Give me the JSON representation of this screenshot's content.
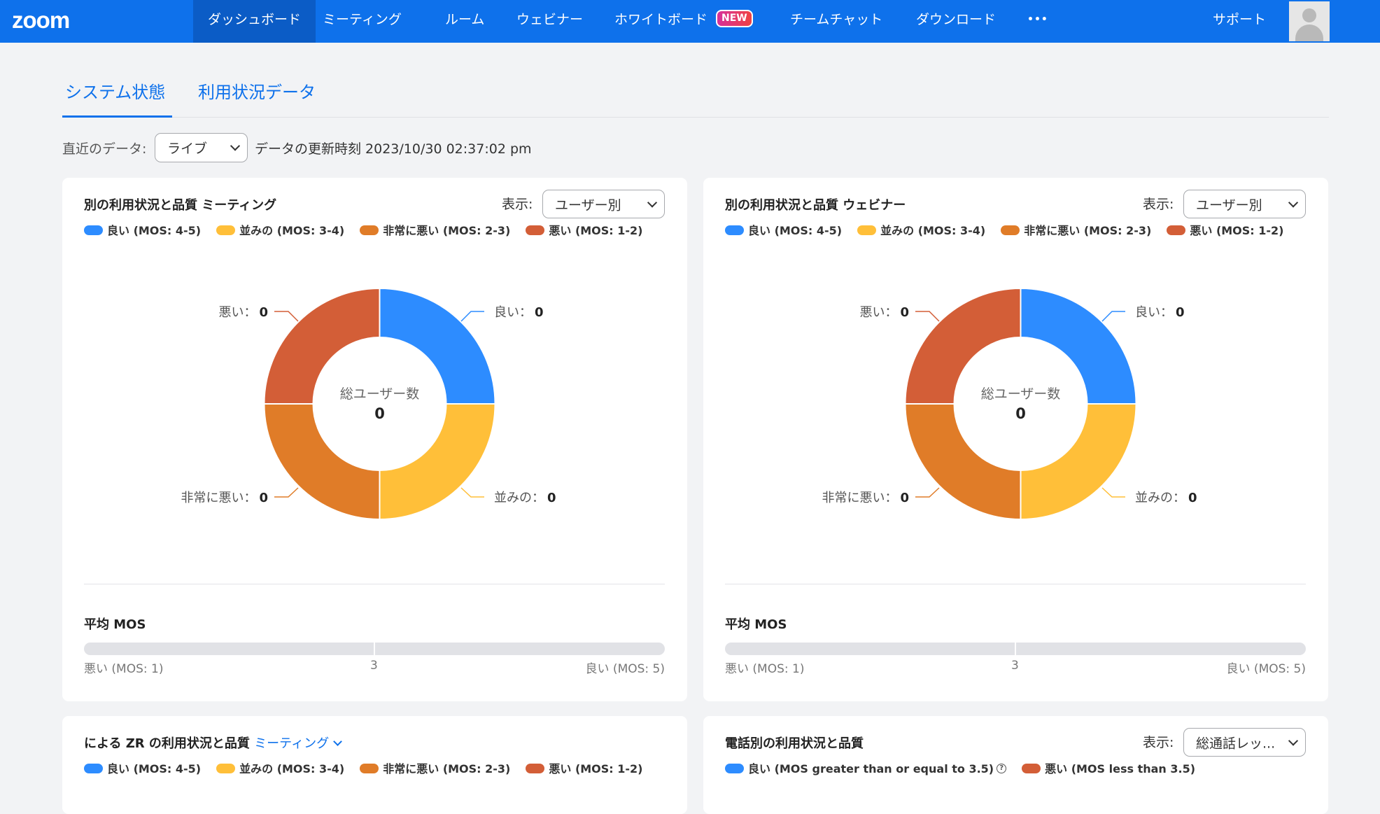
{
  "nav": {
    "logo": "zoom",
    "items": [
      {
        "label": "ダッシュボード",
        "active": true
      },
      {
        "label": "ミーティング"
      },
      {
        "label": "ルーム"
      },
      {
        "label": "ウェビナー"
      },
      {
        "label": "ホワイトボード",
        "badge": "NEW"
      },
      {
        "label": "チームチャット"
      },
      {
        "label": "ダウンロード"
      },
      {
        "label": "•••"
      }
    ],
    "support": "サポート"
  },
  "tabs": [
    {
      "label": "システム状態",
      "active": true
    },
    {
      "label": "利用状況データ"
    }
  ],
  "filter": {
    "label": "直近のデータ:",
    "value": "ライブ",
    "updated": "データの更新時刻 2023/10/30 02:37:02 pm"
  },
  "colors": {
    "good": "#2d8cff",
    "fair": "#ffbf39",
    "poor": "#e07c28",
    "bad": "#d35e37"
  },
  "cards": [
    {
      "title": "別の利用状況と品質 ミーティング",
      "display_label": "表示:",
      "display_value": "ユーザー別",
      "legend": [
        "良い (MOS: 4-5)",
        "並みの (MOS: 3-4)",
        "非常に悪い (MOS: 2-3)",
        "悪い (MOS: 1-2)"
      ],
      "center_label": "総ユーザー数",
      "center_value": "0",
      "segments": [
        {
          "label": "良い：",
          "value": "0"
        },
        {
          "label": "並みの：",
          "value": "0"
        },
        {
          "label": "非常に悪い：",
          "value": "0"
        },
        {
          "label": "悪い：",
          "value": "0"
        }
      ],
      "mos_title": "平均 MOS",
      "mos_left": "悪い (MOS: 1)",
      "mos_mid": "3",
      "mos_right": "良い (MOS: 5)"
    },
    {
      "title": "別の利用状況と品質 ウェビナー",
      "display_label": "表示:",
      "display_value": "ユーザー別",
      "legend": [
        "良い (MOS: 4-5)",
        "並みの (MOS: 3-4)",
        "非常に悪い (MOS: 2-3)",
        "悪い (MOS: 1-2)"
      ],
      "center_label": "総ユーザー数",
      "center_value": "0",
      "segments": [
        {
          "label": "良い：",
          "value": "0"
        },
        {
          "label": "並みの：",
          "value": "0"
        },
        {
          "label": "非常に悪い：",
          "value": "0"
        },
        {
          "label": "悪い：",
          "value": "0"
        }
      ],
      "mos_title": "平均 MOS",
      "mos_left": "悪い (MOS: 1)",
      "mos_mid": "3",
      "mos_right": "良い (MOS: 5)"
    },
    {
      "title_prefix": "による ZR の利用状況と品質",
      "title_link": "ミーティング",
      "legend": [
        "良い (MOS: 4-5)",
        "並みの (MOS: 3-4)",
        "非常に悪い (MOS: 2-3)",
        "悪い (MOS: 1-2)"
      ]
    },
    {
      "title": "電話別の利用状況と品質",
      "display_label": "表示:",
      "display_value": "総通話レッ...",
      "legend": [
        "良い (MOS greater than or equal to 3.5)",
        "悪い (MOS less than 3.5)"
      ],
      "help_icon": "?"
    }
  ]
}
